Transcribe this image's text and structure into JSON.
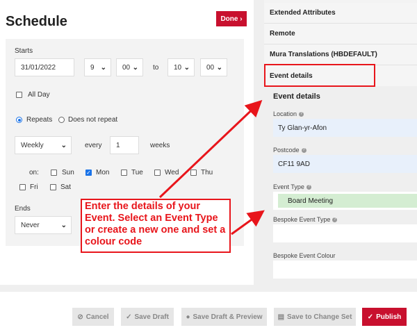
{
  "schedule": {
    "title": "Schedule",
    "done_label": "Done ›",
    "starts_label": "Starts",
    "start_date": "31/01/2022",
    "start_hour": "9",
    "start_min": "00",
    "to_label": "to",
    "end_hour": "10",
    "end_min": "00",
    "allday_label": "All Day",
    "repeats_label": "Repeats",
    "not_repeat_label": "Does not repeat",
    "frequency": "Weekly",
    "every_label": "every",
    "every_value": "1",
    "weeks_label": "weeks",
    "on_label": "on:",
    "days": {
      "sun": "Sun",
      "mon": "Mon",
      "tue": "Tue",
      "wed": "Wed",
      "thu": "Thu",
      "fri": "Fri",
      "sat": "Sat"
    },
    "ends_label": "Ends",
    "ends_value": "Never"
  },
  "sidebar": {
    "items": [
      "Extended Attributes",
      "Remote",
      "Mura Translations (HBDEFAULT)",
      "Event details"
    ]
  },
  "event_details": {
    "title": "Event details",
    "location_label": "Location",
    "location_value": "Ty Glan-yr-Afon",
    "postcode_label": "Postcode",
    "postcode_value": "CF11 9AD",
    "event_type_label": "Event Type",
    "event_type_value": "Board Meeting",
    "bespoke_type_label": "Bespoke Event Type",
    "bespoke_colour_label": "Bespoke Event Colour"
  },
  "footer": {
    "cancel": "Cancel",
    "save_draft": "Save Draft",
    "save_preview": "Save Draft & Preview",
    "save_changeset": "Save to Change Set",
    "publish": "Publish"
  },
  "annotation": {
    "text": "Enter the details of your Event. Select an Event Type or create a new one and set a colour code"
  },
  "colors": {
    "brand_red": "#c8102e",
    "annotation_red": "#e8151b",
    "location_bg": "#e8f0fb",
    "event_type_bg": "#d4edd2",
    "checkbox_blue": "#1a73e8"
  }
}
